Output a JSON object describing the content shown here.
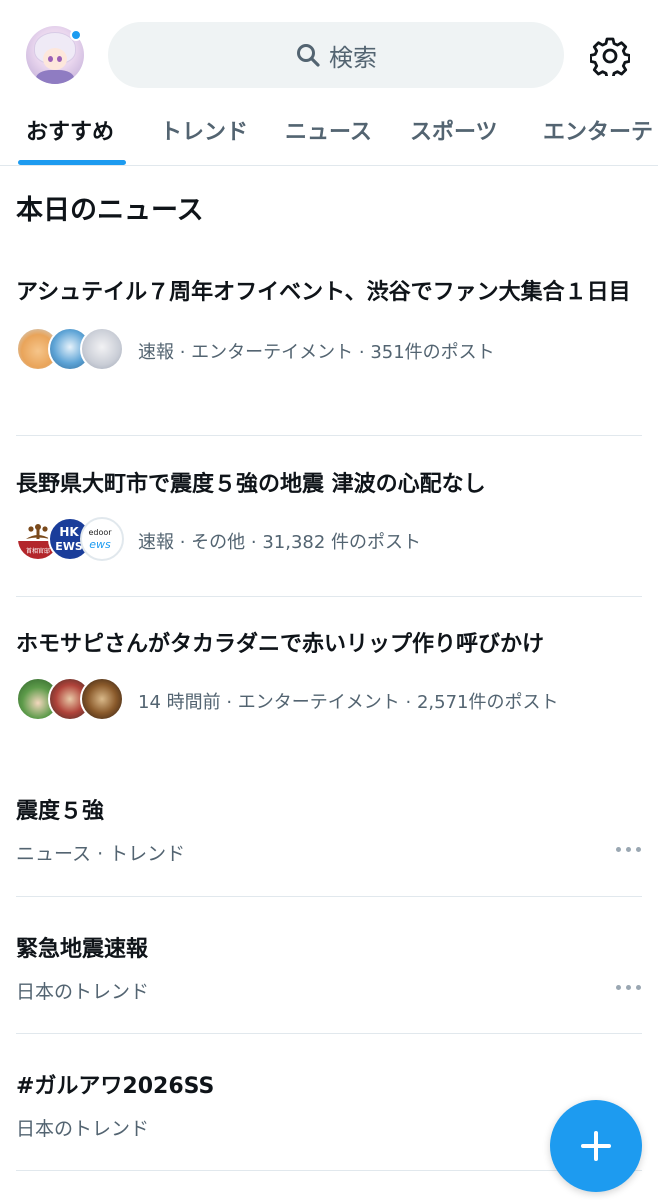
{
  "header": {
    "avatar_icon": "user-avatar",
    "search_label": "検索",
    "search_icon": "search-icon",
    "settings_icon": "gear-icon",
    "accent_color": "#1d9bf0"
  },
  "tabs": [
    {
      "label": "おすすめ",
      "active": true
    },
    {
      "label": "トレンド",
      "active": false
    },
    {
      "label": "ニュース",
      "active": false
    },
    {
      "label": "スポーツ",
      "active": false
    },
    {
      "label": "エンターテ",
      "active": false
    }
  ],
  "section": {
    "title": "本日のニュース"
  },
  "news": [
    {
      "headline": "アシュテイル７周年オフイベント、渋谷でファン大集合１日目",
      "meta": "速報 · エンターテイメント · 351件のポスト"
    },
    {
      "headline": "長野県大町市で震度５強の地震 津波の心配なし",
      "meta": "速報 · その他 · 31,382 件のポスト",
      "avatar_text": {
        "nhk_top": "HK",
        "nhk_bottom": "EWS",
        "livedoor_top": "edoor",
        "livedoor_bottom": "ews",
        "seal_text": "首相官邸"
      }
    },
    {
      "headline": "ホモサピさんがタカラダニで赤いリップ作り呼びかけ",
      "meta": "14 時間前 · エンターテイメント · 2,571件のポスト"
    }
  ],
  "trends": [
    {
      "title": "震度５強",
      "subtitle": "ニュース · トレンド",
      "has_more": true
    },
    {
      "title": "緊急地震速報",
      "subtitle": "日本のトレンド",
      "has_more": true
    },
    {
      "title": "#ガルアワ2026SS",
      "subtitle": "日本のトレンド",
      "has_more": false
    }
  ],
  "fab": {
    "icon": "plus-icon"
  }
}
